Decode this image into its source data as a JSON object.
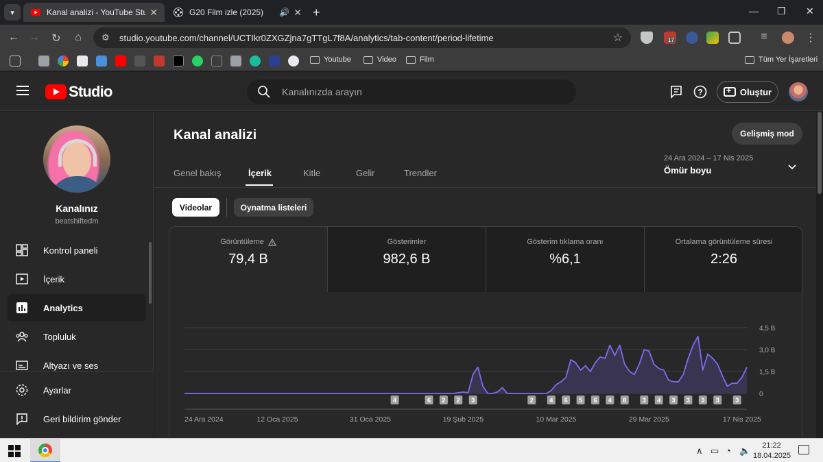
{
  "browser": {
    "tabs": [
      {
        "title": "Kanal analizi - YouTube Studio",
        "active": true
      },
      {
        "title": "G20 Film izle (2025)",
        "active": false
      }
    ],
    "url": "studio.youtube.com/channel/UCTIkr0ZXGZjna7gTTgL7f8A/analytics/tab-content/period-lifetime",
    "extension_badge": "17",
    "bookmarks": {
      "folders": [
        "Youtube",
        "Video",
        "Film"
      ],
      "all_bookmarks_label": "Tüm Yer İşaretleri"
    }
  },
  "studio": {
    "logo_text": "Studio",
    "search_placeholder": "Kanalınızda arayın",
    "create_label": "Oluştur"
  },
  "sidebar": {
    "channel_name": "Kanalınız",
    "channel_handle": "beatshiftedm",
    "items": [
      {
        "label": "Kontrol paneli",
        "icon": "dashboard-icon"
      },
      {
        "label": "İçerik",
        "icon": "content-icon"
      },
      {
        "label": "Analytics",
        "icon": "analytics-icon",
        "active": true
      },
      {
        "label": "Topluluk",
        "icon": "community-icon"
      },
      {
        "label": "Altyazı ve ses",
        "icon": "subtitles-icon"
      }
    ],
    "bottom_items": [
      {
        "label": "Ayarlar",
        "icon": "settings-icon"
      },
      {
        "label": "Geri bildirim gönder",
        "icon": "feedback-icon"
      }
    ]
  },
  "main": {
    "title": "Kanal analizi",
    "advanced_mode_label": "Gelişmiş mod",
    "tabs": [
      "Genel bakış",
      "İçerik",
      "Kitle",
      "Gelir",
      "Trendler"
    ],
    "active_tab": "İçerik",
    "date_range": "24 Ara 2024 – 17 Nis 2025",
    "period": "Ömür boyu",
    "chips": [
      "Videolar",
      "Oynatma listeleri"
    ],
    "metrics": [
      {
        "label": "Görüntüleme",
        "value": "79,4 B",
        "warning": true
      },
      {
        "label": "Gösterimler",
        "value": "982,6 B"
      },
      {
        "label": "Gösterim tıklama oranı",
        "value": "%6,1"
      },
      {
        "label": "Ortalama görüntüleme süresi",
        "value": "2:26"
      }
    ]
  },
  "chart_data": {
    "type": "area",
    "y_tick_labels": [
      "4,5 B",
      "3,0 B",
      "1,5 B",
      "0"
    ],
    "y_ticks": [
      4.5,
      3.0,
      1.5,
      0
    ],
    "ylim": [
      0,
      4.5
    ],
    "x_tick_labels": [
      "24 Ara 2024",
      "12 Oca 2025",
      "31 Oca 2025",
      "19 Şub 2025",
      "10 Mar 2025",
      "29 Mar 2025",
      "17 Nis 2025"
    ],
    "x_tick_days": [
      0,
      19,
      38,
      57,
      76,
      95,
      114
    ],
    "series": [
      {
        "values": [
          0,
          0,
          0,
          0,
          0,
          0,
          0,
          0,
          0,
          0,
          0,
          0,
          0,
          0,
          0,
          0,
          0,
          0,
          0,
          0,
          0,
          0,
          0,
          0,
          0,
          0,
          0,
          0,
          0,
          0,
          0,
          0,
          0,
          0,
          0,
          0,
          0,
          0,
          0,
          0,
          0,
          0,
          0,
          0,
          0,
          0,
          0,
          0,
          0,
          0,
          0,
          0,
          0,
          0,
          0,
          0,
          0.05,
          0.1,
          0.05,
          1.3,
          1.8,
          0.5,
          0,
          0,
          0.1,
          0.4,
          0,
          0,
          0,
          0,
          0,
          0,
          0,
          0,
          0,
          0.2,
          0.6,
          0.8,
          1.1,
          2.3,
          2.1,
          1.6,
          1.9,
          1.5,
          2.1,
          2.5,
          2.4,
          3.3,
          2.6,
          3.3,
          2.0,
          1.5,
          1.3,
          2.0,
          3.0,
          2.9,
          2.0,
          1.7,
          1.6,
          0.9,
          0.8,
          0.8,
          1.3,
          2.4,
          3.3,
          3.9,
          1.6,
          2.7,
          2.4,
          2.0,
          1.2,
          0.5,
          0.7,
          0.7,
          1.1,
          1.8
        ]
      }
    ],
    "annotation_markers": [
      {
        "day": 43,
        "label": "4"
      },
      {
        "day": 50,
        "label": "6"
      },
      {
        "day": 53,
        "label": "2"
      },
      {
        "day": 56,
        "label": "2"
      },
      {
        "day": 59,
        "label": "3"
      },
      {
        "day": 71,
        "label": "2"
      },
      {
        "day": 75,
        "label": "4"
      },
      {
        "day": 78,
        "label": "6"
      },
      {
        "day": 81,
        "label": "5"
      },
      {
        "day": 84,
        "label": "6"
      },
      {
        "day": 87,
        "label": "4"
      },
      {
        "day": 90,
        "label": "8"
      },
      {
        "day": 94,
        "label": "3"
      },
      {
        "day": 97,
        "label": "4"
      },
      {
        "day": 100,
        "label": "3"
      },
      {
        "day": 103,
        "label": "3"
      },
      {
        "day": 106,
        "label": "3"
      },
      {
        "day": 109,
        "label": "3"
      },
      {
        "day": 113,
        "label": "3"
      }
    ],
    "colors": {
      "line": "#7c6cf0",
      "fill": "#3b3654",
      "grid": "#3f3f3f",
      "marker_bg": "#a0a0a0"
    }
  },
  "taskbar": {
    "time": "21:22",
    "date": "18.04.2025"
  }
}
